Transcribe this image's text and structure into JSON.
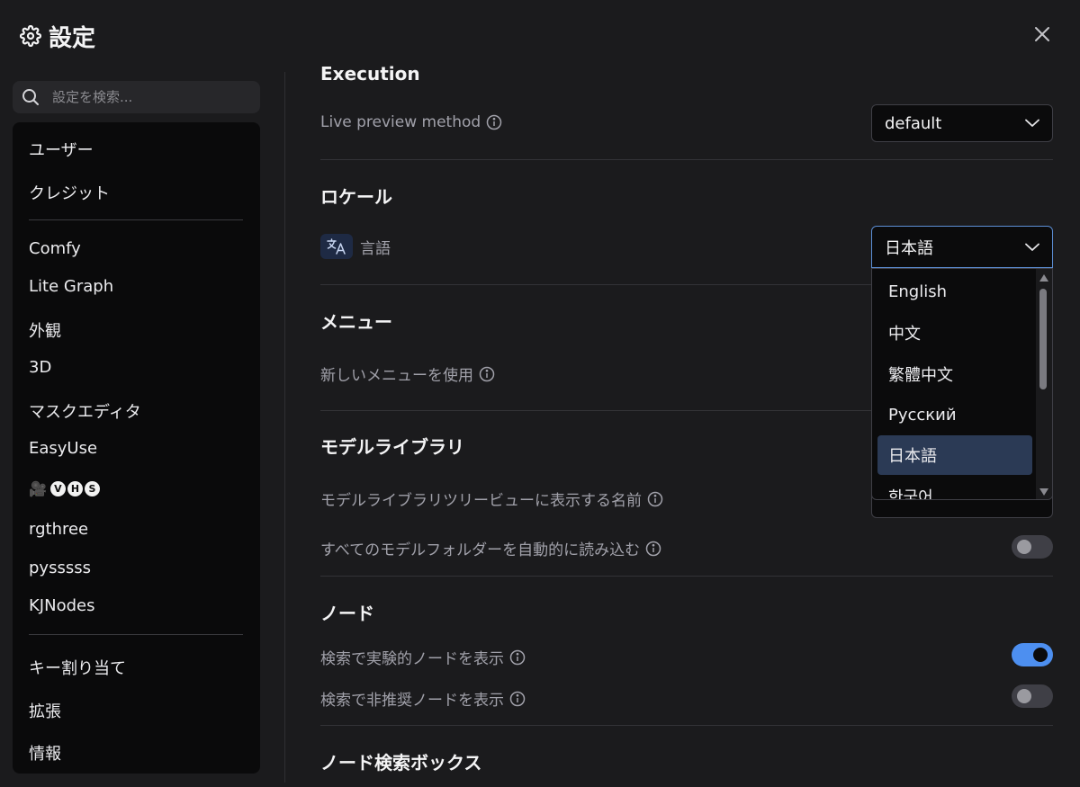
{
  "header": {
    "title": "設定"
  },
  "sidebar": {
    "search_placeholder": "設定を検索...",
    "items": [
      {
        "label": "ユーザー"
      },
      {
        "label": "クレジット"
      },
      {
        "label": "Comfy"
      },
      {
        "label": "Lite Graph"
      },
      {
        "label": "外観"
      },
      {
        "label": "3D"
      },
      {
        "label": "マスクエディタ"
      },
      {
        "label": "EasyUse"
      },
      {
        "label": "VHS",
        "badges": [
          "V",
          "H",
          "S"
        ],
        "icon": "camera-icon"
      },
      {
        "label": "rgthree"
      },
      {
        "label": "pysssss"
      },
      {
        "label": "KJNodes"
      },
      {
        "label": "キー割り当て"
      },
      {
        "label": "拡張"
      },
      {
        "label": "情報"
      }
    ]
  },
  "main": {
    "execution": {
      "title": "Execution",
      "live_preview_label": "Live preview method",
      "live_preview_value": "default"
    },
    "locale": {
      "title": "ロケール",
      "language_label": "言語",
      "language_value": "日本語",
      "options": [
        "English",
        "中文",
        "繁體中文",
        "Русский",
        "日本語",
        "한국어"
      ],
      "selected_index": 4
    },
    "menu": {
      "title": "メニュー",
      "new_menu_label": "新しいメニューを使用"
    },
    "model_library": {
      "title": "モデルライブラリ",
      "tree_name_label": "モデルライブラリツリービューに表示する名前",
      "auto_load_label": "すべてのモデルフォルダーを自動的に読み込む",
      "auto_load_on": false
    },
    "node": {
      "title": "ノード",
      "experimental_label": "検索で実験的ノードを表示",
      "experimental_on": true,
      "deprecated_label": "検索で非推奨ノードを表示",
      "deprecated_on": false
    },
    "node_search_box": {
      "title": "ノード検索ボックス"
    }
  },
  "colors": {
    "accent": "#4d8ff0",
    "selected_option": "#2b3a55",
    "background": "#1b1b1d"
  }
}
